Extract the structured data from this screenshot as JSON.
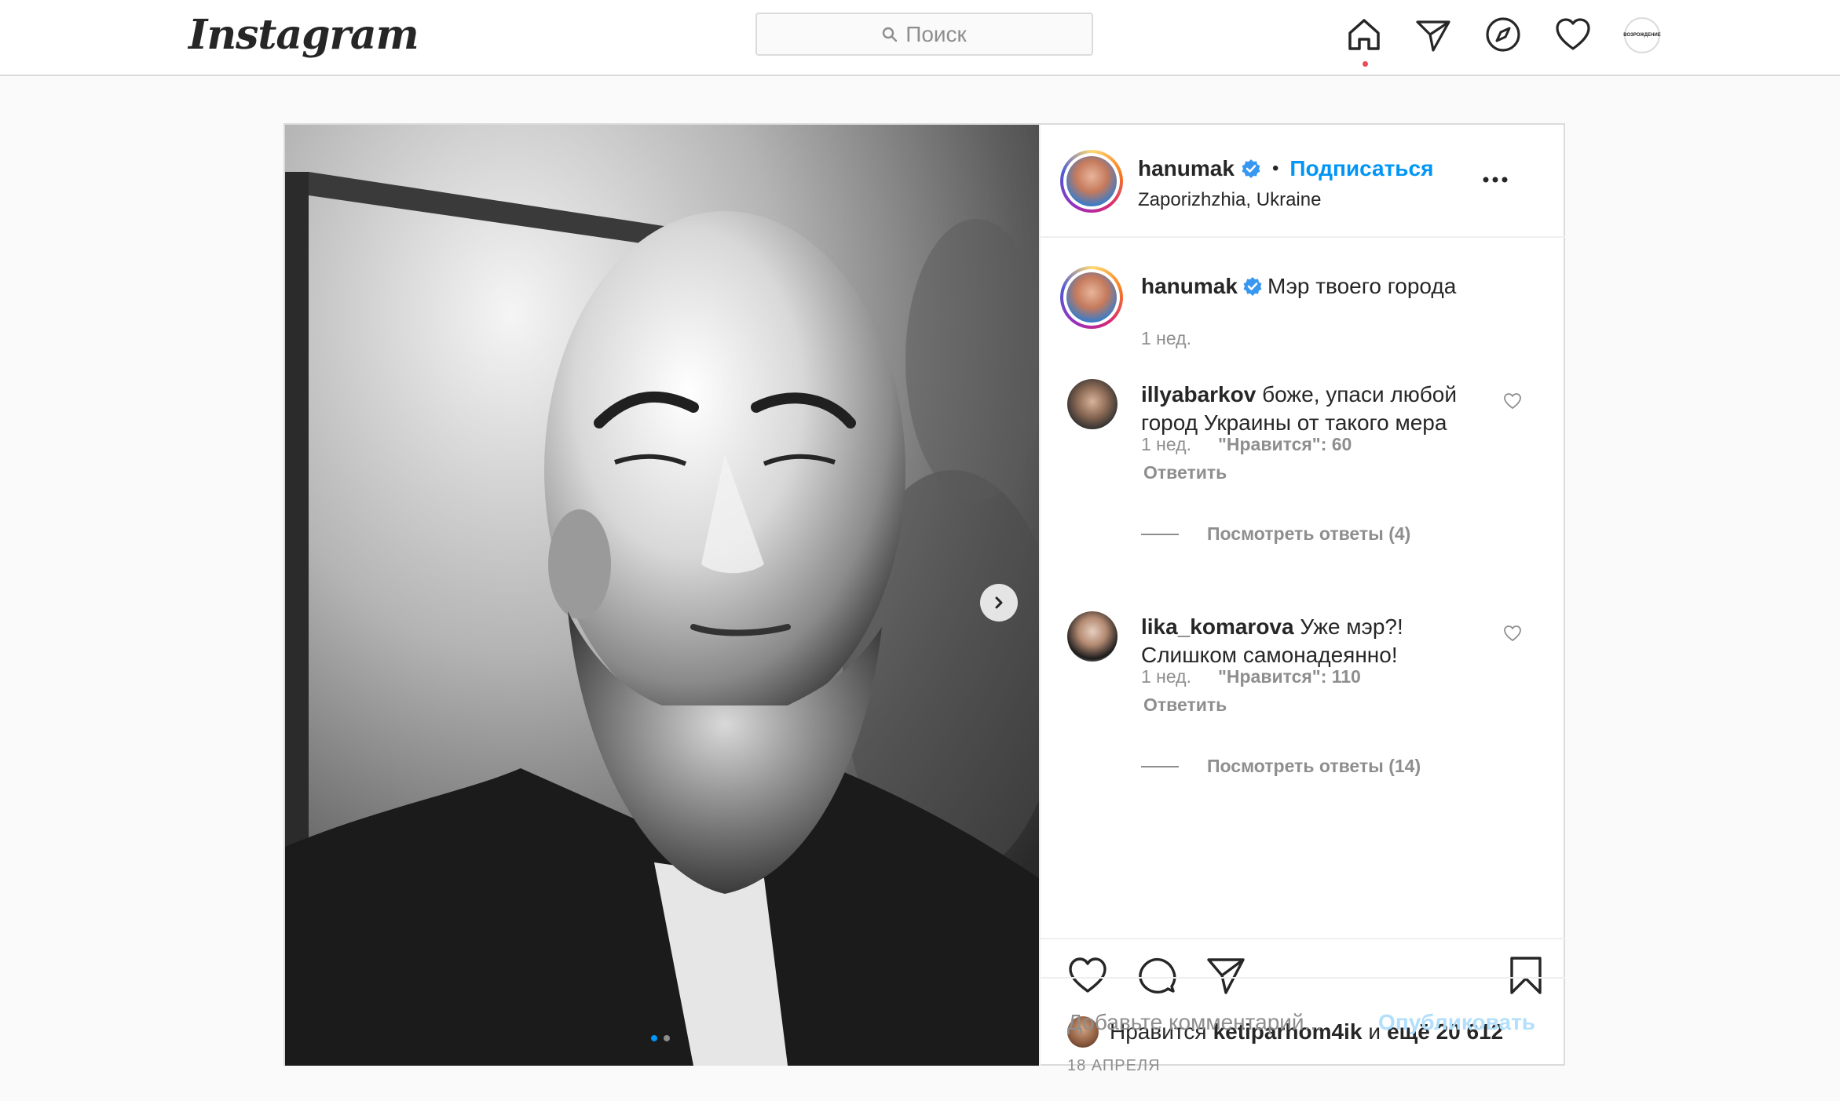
{
  "header": {
    "logo": "Instagram",
    "search_placeholder": "Поиск",
    "nav": [
      "home-icon",
      "direct-icon",
      "explore-icon",
      "activity-icon",
      "profile-avatar"
    ],
    "profile_avatar_text": "ВОЗРОЖДЕНИЕ"
  },
  "post": {
    "author": "hanumak",
    "follow_label": "Подписаться",
    "separator": "•",
    "location": "Zaporizhzhia, Ukraine",
    "caption": {
      "username": "hanumak",
      "text": "Мэр твоего города",
      "time": "1 нед."
    },
    "comments": [
      {
        "username": "illyabarkov",
        "text_line1": "боже, упаси любой",
        "text_line2": "город Украины от такого мера",
        "time": "1 нед.",
        "likes": "\"Нравится\": 60",
        "reply_label": "Ответить",
        "view_replies": "Посмотреть ответы (4)"
      },
      {
        "username": "lika_komarova",
        "text_line1": "Уже мэр?!",
        "text_line2": "Слишком самонадеянно!",
        "time": "1 нед.",
        "likes": "\"Нравится\": 110",
        "reply_label": "Ответить",
        "view_replies": "Посмотреть ответы (14)"
      }
    ],
    "likes_prefix": "Нравится",
    "likes_user": "ketiparhom4ik",
    "likes_and": "и",
    "likes_more": "ещё 20 612",
    "date": "18 АПРЕЛЯ",
    "comment_placeholder": "Добавьте комментарий...",
    "publish_label": "Опубликовать"
  },
  "colors": {
    "accent": "#0095f6",
    "text": "#262626",
    "muted": "#8e8e8e",
    "border": "#dbdbdb",
    "publish_disabled": "#b2dffc",
    "notification": "#ed4956"
  }
}
